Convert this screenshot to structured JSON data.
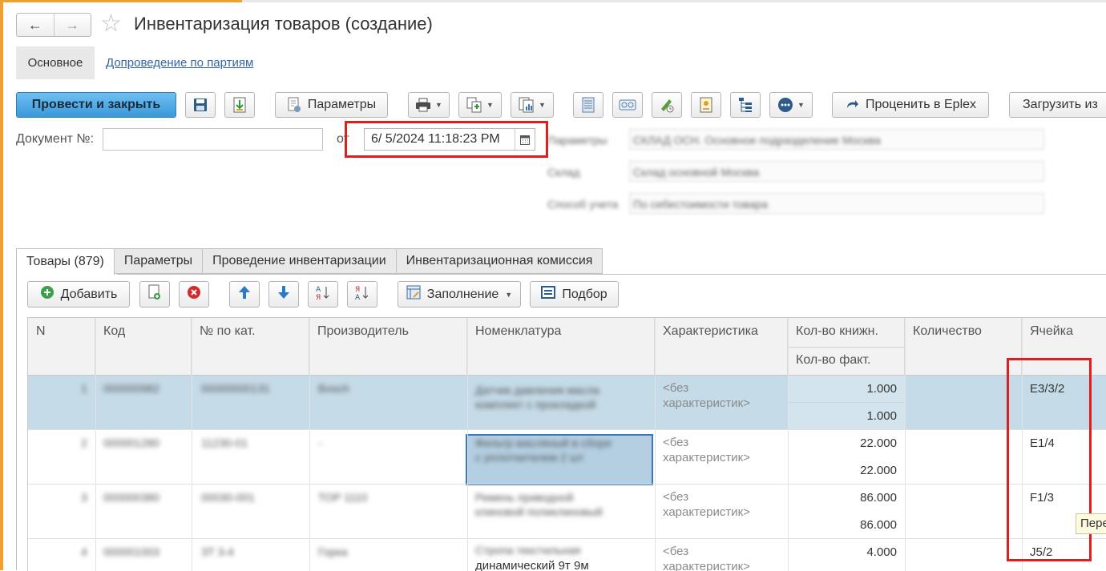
{
  "window": {
    "title": "Инвентаризация товаров (создание)",
    "nav_back": "←",
    "nav_forward": "→",
    "favorite_icon": "star-icon"
  },
  "subnav": {
    "main": "Основное",
    "link": "Допроведение по партиям"
  },
  "toolbar": {
    "post_close": "Провести и закрыть",
    "params": "Параметры",
    "eplex": "Проценить в Eplex",
    "load": "Загрузить из",
    "icons": [
      "save-icon",
      "post-icon",
      "print-icon",
      "create-based-icon",
      "reports-icon",
      "list-icon",
      "barcode-icon",
      "sign-icon",
      "document-icon",
      "tree-icon",
      "more-icon"
    ]
  },
  "header": {
    "doc_number_label": "Документ №:",
    "doc_number_value": "",
    "from_label": "от",
    "date_value": "6/ 5/2024 11:18:23 PM",
    "blurred_labels": [
      "Параметры",
      "Склад",
      "Способ учета"
    ],
    "blurred_values": [
      "СКЛАД ОСН. Основное подразделение Москва",
      "Склад основной Москва",
      "По себестоимости товара"
    ]
  },
  "tabs": {
    "goods": "Товары (879)",
    "params": "Параметры",
    "conduct": "Проведение инвентаризации",
    "commission": "Инвентаризационная комиссия"
  },
  "table_toolbar": {
    "add": "Добавить",
    "fill": "Заполнение",
    "pick": "Подбор"
  },
  "table": {
    "columns": {
      "n": "N",
      "code": "Код",
      "catalog_no": "№ по кат.",
      "manufacturer": "Производитель",
      "nomenclature": "Номенклатура",
      "characteristic": "Характеристика",
      "qty_book": "Кол-во книжн.",
      "qty_fact": "Кол-во факт.",
      "quantity": "Количество",
      "cell": "Ячейка"
    },
    "rows": [
      {
        "n": "1",
        "code": "000000982",
        "catalog": "00000000131",
        "manufacturer": "Bosch",
        "nomenclature_l1": "Датчик давления масла",
        "nomenclature_l2": "комплект с прокладкой",
        "char_l1": "<без",
        "char_l2": "характеристик>",
        "book": "1.000",
        "fact": "1.000",
        "cell": "E3/3/2"
      },
      {
        "n": "2",
        "code": "000001280",
        "catalog": "11230-01",
        "manufacturer": "-",
        "nomenclature_l1": "Фильтр масляный в сборе",
        "nomenclature_l2": "с уплотнителем 2 шт",
        "char_l1": "<без",
        "char_l2": "характеристик>",
        "book": "22.000",
        "fact": "22.000",
        "cell": "E1/4"
      },
      {
        "n": "3",
        "code": "000000380",
        "catalog": "00030-001",
        "manufacturer": "TOP 1110",
        "nomenclature_l1": "Ремень приводной",
        "nomenclature_l2": "клиновой поликлиновый",
        "char_l1": "<без",
        "char_l2": "характеристик>",
        "book": "86.000",
        "fact": "86.000",
        "cell": "F1/3"
      },
      {
        "n": "4",
        "code": "000001003",
        "catalog": "ЗТ 3-4",
        "manufacturer": "Горка",
        "nomenclature_l1": "Стропа текстильная",
        "nomenclature_l2": "динамический 9т 9м",
        "char_l1": "<без",
        "char_l2": "характеристик>",
        "book": "4.000",
        "fact": "",
        "cell": "J5/2"
      }
    ]
  },
  "tooltip": "Перемещение",
  "colors": {
    "accent": "#3a98da",
    "selection": "#c5dbe8",
    "highlight": "#e01e1e",
    "link": "#3366aa"
  }
}
